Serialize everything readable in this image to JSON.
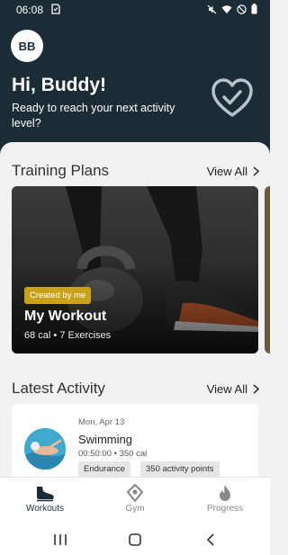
{
  "status": {
    "time": "06:08"
  },
  "header": {
    "avatar_initials": "BB",
    "greeting": "Hi, Buddy!",
    "subtitle": "Ready to reach your next activity level?"
  },
  "training_plans": {
    "title": "Training Plans",
    "view_all": "View All",
    "cards": [
      {
        "tag": "Created by me",
        "name": "My Workout",
        "meta": "68 cal • 7 Exercises"
      }
    ]
  },
  "latest_activity": {
    "title": "Latest Activity",
    "view_all": "View All",
    "items": [
      {
        "date": "Mon, Apr 13",
        "name": "Swimming",
        "meta": "00:50:00 • 350 cal",
        "tags": [
          "Endurance",
          "350 activity points"
        ]
      }
    ]
  },
  "bottom_nav": {
    "items": [
      {
        "label": "Workouts",
        "icon": "shoe-icon",
        "active": true
      },
      {
        "label": "Gym",
        "icon": "location-pin-icon",
        "active": false
      },
      {
        "label": "Progress",
        "icon": "flame-icon",
        "active": false
      }
    ]
  },
  "colors": {
    "header_bg": "#1c2c37",
    "tag_gold": "#c9a21a",
    "active_nav": "#1c2c37",
    "inactive_nav": "#8a8a8a"
  }
}
